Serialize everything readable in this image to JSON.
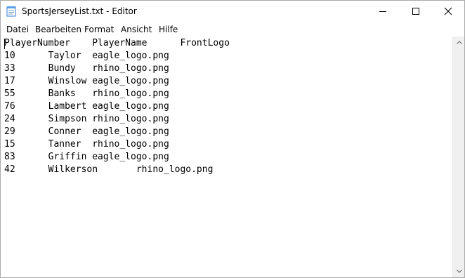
{
  "window": {
    "title": "SportsJerseyList.txt - Editor"
  },
  "menu": {
    "items": [
      "Datei",
      "Bearbeiten",
      "Format",
      "Ansicht",
      "Hilfe"
    ]
  },
  "editor": {
    "lines": [
      "PlayerNumber    PlayerName      FrontLogo",
      "10      Taylor  eagle_logo.png",
      "33      Bundy   rhino_logo.png",
      "17      Winslow eagle_logo.png",
      "55      Banks   rhino_logo.png",
      "76      Lambert eagle_logo.png",
      "24      Simpson rhino_logo.png",
      "29      Conner  eagle_logo.png",
      "15      Tanner  rhino_logo.png",
      "83      Griffin eagle_logo.png",
      "42      Wilkerson       rhino_logo.png"
    ]
  },
  "icons": {
    "app": "notepad-icon",
    "minimize": "minimize-icon",
    "maximize": "maximize-icon",
    "close": "close-icon",
    "scroll_up": "chevron-up-icon",
    "scroll_down": "chevron-down-icon"
  }
}
